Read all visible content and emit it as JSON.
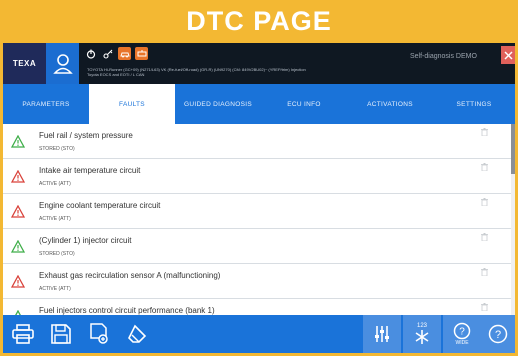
{
  "banner": {
    "title": "DTC PAGE"
  },
  "topbar": {
    "logo": "TEXA",
    "vehicle_line1": "TOYOTA Hi-Runner (GC+09) (N271/L63) VK (Re-fuel/Off-road) (GR-R) (UN9270) (CM: 849V2BU02)~ (YREP/trim) Injection",
    "vehicle_line2": "Toyota EOCS and EOTI / L CAN",
    "mode": "Self-diagnosis DEMO",
    "icons": [
      "power-icon",
      "key-icon",
      "car-icon",
      "car-alert-icon"
    ]
  },
  "tabs": [
    {
      "label": "PARAMETERS",
      "active": false
    },
    {
      "label": "FAULTS",
      "active": true
    },
    {
      "label": "GUIDED DIAGNOSIS",
      "active": false
    },
    {
      "label": "ECU INFO",
      "active": false
    },
    {
      "label": "ACTIVATIONS",
      "active": false
    },
    {
      "label": "SETTINGS",
      "active": false
    }
  ],
  "faults": [
    {
      "title": "Fuel rail / system pressure",
      "status": "STORED (STO)",
      "color": "#3fae49"
    },
    {
      "title": "Intake air temperature circuit",
      "status": "ACTIVE (ATT)",
      "color": "#d9423a"
    },
    {
      "title": "Engine coolant temperature circuit",
      "status": "ACTIVE (ATT)",
      "color": "#d9423a"
    },
    {
      "title": "(Cylinder 1) injector circuit",
      "status": "STORED (STO)",
      "color": "#3fae49"
    },
    {
      "title": "Exhaust gas recirculation sensor A (malfunctioning)",
      "status": "ACTIVE (ATT)",
      "color": "#d9423a"
    },
    {
      "title": "Fuel injectors control circuit performance (bank 1)",
      "status": "",
      "color": "#3fae49"
    }
  ],
  "bottombar": {
    "left_icons": [
      "print-icon",
      "save-icon",
      "report-icon",
      "erase-icon"
    ],
    "right_buttons": [
      "adjust-icon",
      "numeric-icon",
      "help-wide-icon",
      "help-icon"
    ],
    "numeric_label": "123",
    "help_wide_label": "WIDE"
  }
}
